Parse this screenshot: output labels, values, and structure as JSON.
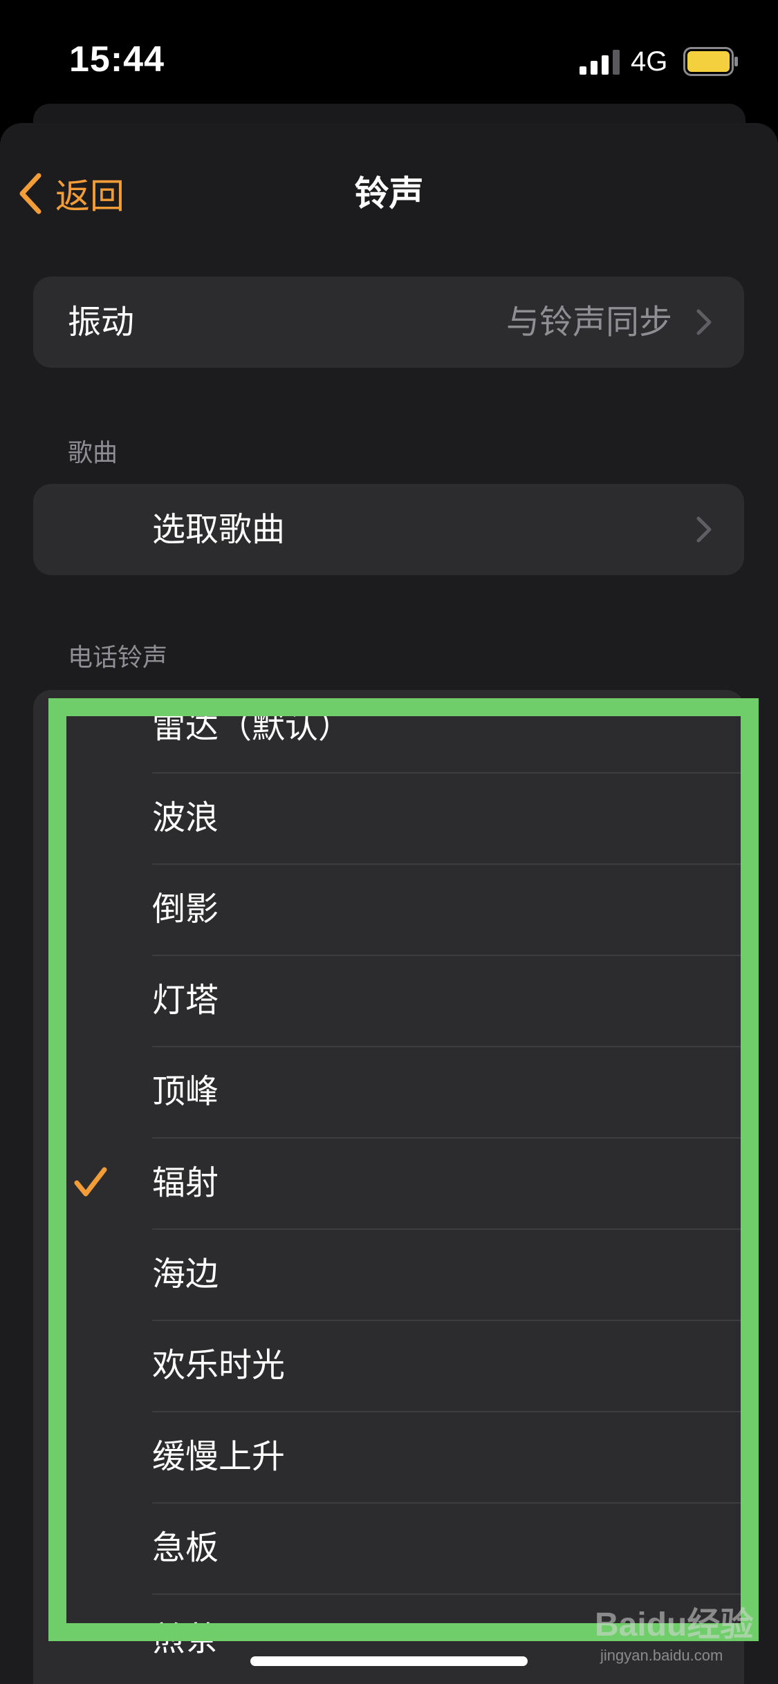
{
  "status_bar": {
    "time": "15:44",
    "network": "4G",
    "signal_icon": "cellular-signal-icon",
    "battery_icon": "battery-icon",
    "battery_color": "#f4d03f"
  },
  "nav": {
    "back_label": "返回",
    "title": "铃声",
    "accent_color": "#f29d38"
  },
  "vibration": {
    "label": "振动",
    "value": "与铃声同步"
  },
  "songs": {
    "header": "歌曲",
    "pick_label": "选取歌曲"
  },
  "ringtones": {
    "header": "电话铃声",
    "selected": "辐射",
    "items": [
      {
        "label": "雷达（默认）"
      },
      {
        "label": "波浪"
      },
      {
        "label": "倒影"
      },
      {
        "label": "灯塔"
      },
      {
        "label": "顶峰"
      },
      {
        "label": "辐射"
      },
      {
        "label": "海边"
      },
      {
        "label": "欢乐时光"
      },
      {
        "label": "缓慢上升"
      },
      {
        "label": "急板"
      },
      {
        "label": "煎茶"
      }
    ]
  },
  "annotation": {
    "highlight_color": "#6fce6a"
  },
  "watermark": {
    "brand": "Baidu经验",
    "url": "jingyan.baidu.com"
  }
}
